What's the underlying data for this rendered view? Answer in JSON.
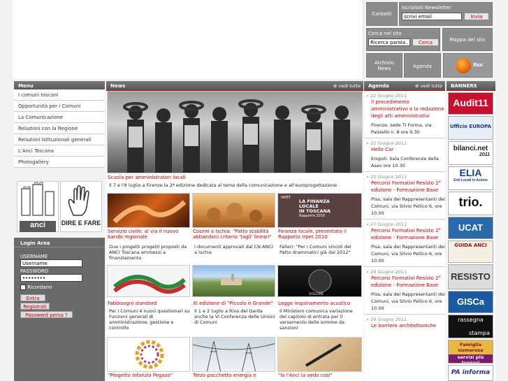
{
  "header": {
    "contatti": "Contatti",
    "newsletter_title": "Iscrizioni Newsletter",
    "newsletter_placeholder": "scrivi email",
    "invia": "Invia",
    "cerca_title": "Cerca nel sito",
    "cerca_placeholder": "Ricerca parola...",
    "cerca_button": "Cerca",
    "mappa": "Mappa del sito",
    "archivio_line1": "Archivio",
    "archivio_line2": "News",
    "agenda": "Agenda",
    "rss": "Rss"
  },
  "menu": {
    "title": "Menu",
    "items": [
      "I comuni toscani",
      "Opportunità per i Comuni",
      "La Comunicazione",
      "Relazioni con la Regione",
      "Relazioni istituzionali generali",
      "L'Anci Toscana",
      "Photogallery"
    ]
  },
  "logos": {
    "anci": "anci",
    "direfare": "DIRE E FARE"
  },
  "login": {
    "title": "Login Area",
    "username_label": "USERNAME",
    "username_value": "Username",
    "password_label": "PASSWORD",
    "password_value": "••••••••",
    "remember": "Ricordami",
    "entra": "Entra",
    "registrati": "Registrati",
    "password_reset": "Password persa ?"
  },
  "news": {
    "title": "News",
    "vedi": "vedi tutte",
    "featured_title": "Scuola per amministratori locali",
    "featured_text": "Il 7 e l'8 luglio a Firenze la 2ª edizione dedicata al tema della comunicazione e all'europrogettazione",
    "finanza_img": {
      "line1": "LA FINANZA",
      "line2": "LOCALE",
      "line3": "IN TOSCANA",
      "sub": "Rapporto 2010",
      "brand": "IRPET"
    },
    "volume_img": "VOLUME",
    "items": [
      {
        "title": "Servizio civile: al via il nuovo bando regionale",
        "text": "Due i progetti progetti proposti da ANCI Toscana ammessi a finanziamento"
      },
      {
        "title": "Cosimi a Ischia: \"Patto stabilità abbandoni criterio 'tagli' lineari\"",
        "text": "I documenti approvati dal CN ANCI a Ischia"
      },
      {
        "title": "Finanza locale, presentato il Rapporto Irpet 2010",
        "text": "Falleri: \"Per i Comuni vincoli del Patto drammatici già dal 2012\""
      },
      {
        "title": "Fabbisogni standard",
        "text": "Per i Comuni 4 nuovi questionari su Funzioni generali di amministrazione, gestione e controllo"
      },
      {
        "title": "XI edizione di \"Piccolo è Grande\"",
        "text": "Il 1 e 2 luglio a Riva del Garda anche la VI Conferenza delle Unioni di Comuni"
      },
      {
        "title": "Legge inquinamento acustico",
        "text": "Il Ministero comunica variazione del capitolo di entrata per il versamento delle somme da sanzioni"
      },
      {
        "title": "\"Progetto Infanzia Pegaso\"",
        "text": ""
      },
      {
        "title": "Terzo pacchetto energia e",
        "text": ""
      },
      {
        "title": "\"Io l'Anci la vedo così\"",
        "text": ""
      }
    ]
  },
  "agenda": {
    "title": "Agenda",
    "vedi": "vedi tutte",
    "items": [
      {
        "date": "22 Giugno 2011",
        "title": "Il procedimento amministrativo e la redazione degli atti amministrativi",
        "desc": "Firenze, sede Ti Forma, via Paisiello n. 8 ore 9.30"
      },
      {
        "date": "22 Giugno 2011",
        "title": "Hello Car",
        "desc": "Empoli. Sala Conferenze della Asev ore 10.30"
      },
      {
        "date": "22 Giugno 2011",
        "title": "Percorsi Formativi Resisto 2° edizione - Formazione Base",
        "desc": "Pisa, sala dei Rappresentanti dei Comuni, via Silvio Pellico 6, ore 10.00"
      },
      {
        "date": "27 Giugno 2011",
        "title": "Percorsi Formativi Resisto 2° edizione - Formazione Base",
        "desc": "Pisa, sala dei Rappresentanti dei Comuni, via Silvio Pellico 6, ore 10.00"
      },
      {
        "date": "29 Giugno 2011",
        "title": "Percorsi Formativi Resisto 2° edizione - Formazione Base",
        "desc": "Pisa, sala dei Rappresentanti dei Comuni, via Silvio Pellico 6, ore 10.00"
      },
      {
        "date": "29 Giugno 2011",
        "title": "Le barriere architettoniche",
        "desc": ""
      }
    ]
  },
  "banners": {
    "title": "BANNERS",
    "items": [
      {
        "name": "audit11",
        "label": "Audit11"
      },
      {
        "name": "ufficio-europa",
        "label": "Ufficio EUROPA"
      },
      {
        "name": "bilanci-net",
        "label": "bilanci.net",
        "sub": "2011"
      },
      {
        "name": "elia",
        "label": "ELIA",
        "sub": "Enti Locali in Azione"
      },
      {
        "name": "trio",
        "label": "trio."
      },
      {
        "name": "ucat",
        "label": "UCAT"
      },
      {
        "name": "guida-anci",
        "label": "GUIDA ANCI"
      },
      {
        "name": "resisto",
        "label": "RESISTO"
      },
      {
        "name": "gisca",
        "label": "GISCa"
      },
      {
        "name": "rassegna-stampa",
        "label": "rassegna",
        "sub": "stampa"
      },
      {
        "name": "famiglia-numerosa",
        "label": "Famiglia numerosa",
        "sub": "servizi più leggeri"
      },
      {
        "name": "pa-informa",
        "label": "PA informa"
      }
    ]
  },
  "colors": {
    "accent": "#cc0000",
    "panel": "#6a6a6a"
  }
}
